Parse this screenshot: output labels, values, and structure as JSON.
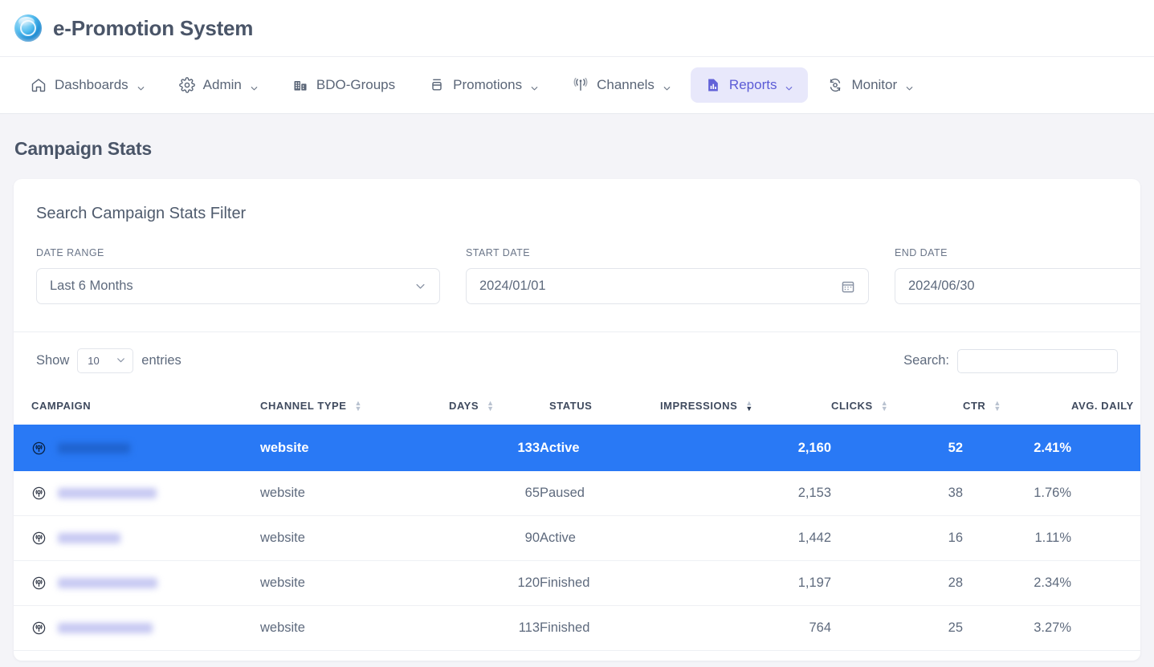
{
  "app": {
    "title": "e-Promotion System",
    "logo_icon": "globe-logo-icon"
  },
  "nav": {
    "items": [
      {
        "label": "Dashboards",
        "icon": "home-icon",
        "has_caret": true,
        "active": false
      },
      {
        "label": "Admin",
        "icon": "gear-icon",
        "has_caret": true,
        "active": false
      },
      {
        "label": "BDO-Groups",
        "icon": "building-icon",
        "has_caret": false,
        "active": false
      },
      {
        "label": "Promotions",
        "icon": "megaphone-icon",
        "has_caret": true,
        "active": false
      },
      {
        "label": "Channels",
        "icon": "broadcast-icon",
        "has_caret": true,
        "active": false
      },
      {
        "label": "Reports",
        "icon": "report-chart-icon",
        "has_caret": true,
        "active": true
      },
      {
        "label": "Monitor",
        "icon": "refresh-monitor-icon",
        "has_caret": true,
        "active": false
      }
    ]
  },
  "page": {
    "title": "Campaign Stats"
  },
  "filter": {
    "heading": "Search Campaign Stats Filter",
    "date_range": {
      "label": "DATE RANGE",
      "value": "Last 6 Months",
      "icon": "chevron-down-icon"
    },
    "start_date": {
      "label": "START DATE",
      "value": "2024/01/01",
      "icon": "calendar-icon"
    },
    "end_date": {
      "label": "END DATE",
      "value": "2024/06/30"
    }
  },
  "toolbar": {
    "show_label": "Show",
    "entries_label": "entries",
    "entries_value": "10",
    "search_label": "Search:",
    "search_value": "",
    "search_placeholder": ""
  },
  "table": {
    "columns": [
      {
        "label": "CAMPAIGN",
        "align": "left",
        "sort": "none"
      },
      {
        "label": "CHANNEL TYPE",
        "align": "left",
        "sort": "none"
      },
      {
        "label": "DAYS",
        "align": "left",
        "sort": "none"
      },
      {
        "label": "STATUS",
        "align": "left",
        "sort": "none"
      },
      {
        "label": "IMPRESSIONS",
        "align": "left",
        "sort": "desc"
      },
      {
        "label": "CLICKS",
        "align": "left",
        "sort": "none"
      },
      {
        "label": "CTR",
        "align": "left",
        "sort": "none"
      },
      {
        "label": "AVG. DAILY",
        "align": "left",
        "sort": "none"
      }
    ],
    "rows": [
      {
        "campaign": "",
        "campaign_redacted": true,
        "campaign_width": 90,
        "channel_type": "website",
        "days": "133",
        "status": "Active",
        "impressions": "2,160",
        "clicks": "52",
        "ctr": "2.41%",
        "selected": true
      },
      {
        "campaign": "",
        "campaign_redacted": true,
        "campaign_width": 123,
        "channel_type": "website",
        "days": "65",
        "status": "Paused",
        "impressions": "2,153",
        "clicks": "38",
        "ctr": "1.76%",
        "selected": false
      },
      {
        "campaign": "",
        "campaign_redacted": true,
        "campaign_width": 78,
        "channel_type": "website",
        "days": "90",
        "status": "Active",
        "impressions": "1,442",
        "clicks": "16",
        "ctr": "1.11%",
        "selected": false
      },
      {
        "campaign": "",
        "campaign_redacted": true,
        "campaign_width": 124,
        "channel_type": "website",
        "days": "120",
        "status": "Finished",
        "impressions": "1,197",
        "clicks": "28",
        "ctr": "2.34%",
        "selected": false
      },
      {
        "campaign": "",
        "campaign_redacted": true,
        "campaign_width": 118,
        "channel_type": "website",
        "days": "113",
        "status": "Finished",
        "impressions": "764",
        "clicks": "25",
        "ctr": "3.27%",
        "selected": false
      }
    ],
    "row_icon": "broadcast-radar-icon"
  },
  "colors": {
    "accent_blue": "#2979f5",
    "nav_active_bg": "#e8e8fb",
    "nav_active_fg": "#5b5bd6",
    "page_bg": "#f4f4f8",
    "text": "#5e6a7d"
  }
}
